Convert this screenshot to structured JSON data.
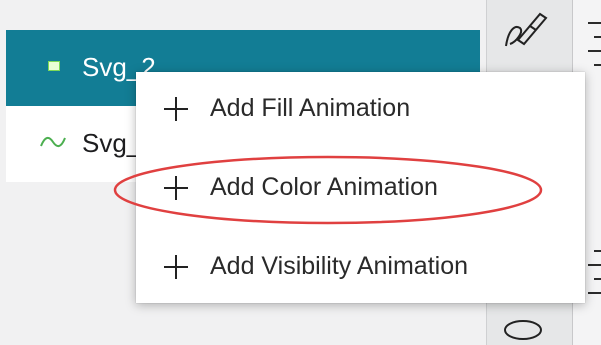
{
  "layers": [
    {
      "label": "Svg_2",
      "selected": true,
      "icon": "rectangle-icon"
    },
    {
      "label": "Svg_",
      "selected": false,
      "icon": "wave-icon"
    }
  ],
  "context_menu": {
    "items": [
      {
        "label": "Add Fill Animation",
        "icon": "plus-icon"
      },
      {
        "label": "Add Color Animation",
        "icon": "plus-icon",
        "highlighted": true
      },
      {
        "label": "Add Visibility Animation",
        "icon": "plus-icon"
      }
    ]
  },
  "toolbar": {
    "tools": [
      "pen-icon",
      "ellipse-icon"
    ]
  },
  "colors": {
    "selected_row": "#127d95",
    "highlight_ring": "#e04040",
    "panel_bg": "#f1f1f2"
  }
}
